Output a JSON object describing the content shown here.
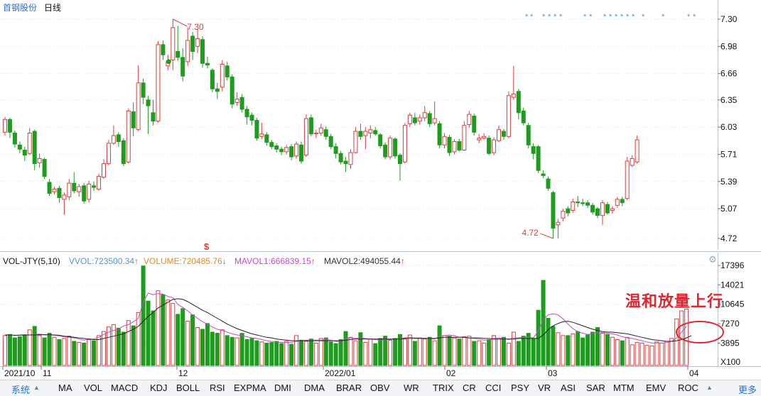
{
  "header": {
    "stock_name": "首钢股份",
    "period": "日线"
  },
  "price_axis": {
    "ticks": [
      "7.30",
      "6.98",
      "6.66",
      "6.35",
      "6.03",
      "5.71",
      "5.39",
      "5.07",
      "4.72"
    ]
  },
  "volume_axis": {
    "ticks": [
      "17396",
      "14021",
      "10645",
      "7270",
      "3895"
    ],
    "unit": "X100"
  },
  "date_axis": {
    "labels": [
      "2021/10",
      "11",
      "12",
      "2022/01",
      "02",
      "03",
      "04"
    ]
  },
  "markers": {
    "high_label": "7.30",
    "low_label": "4.72",
    "signal_label": "$"
  },
  "indicator": {
    "name": "VOL-JTY(5,10)",
    "items": [
      {
        "label": "VVOL:723500.34",
        "arrow": "↑",
        "color": "#4f95d6"
      },
      {
        "label": "VOLUME:720485.76",
        "arrow": "↓",
        "color": "#e08a1e"
      },
      {
        "label": "MAVOL1:666839.15",
        "arrow": "↑",
        "color": "#c44cc4"
      },
      {
        "label": "MAVOL2:494055.44",
        "arrow": "↑",
        "color": "#333333"
      }
    ]
  },
  "annotation": {
    "text": "温和放量上行"
  },
  "bottom_tabs": [
    "系统",
    "MA",
    "VOL",
    "MACD",
    "KDJ",
    "BOLL",
    "RSI",
    "EXPMA",
    "DMI",
    "DMA",
    "BRAR",
    "OBV",
    "WR",
    "TRIX",
    "CR",
    "CCI",
    "PSY",
    "VR",
    "ASI",
    "SAR",
    "MTM",
    "EMV",
    "ROC"
  ],
  "more_label": "更多",
  "colors": {
    "up": "#e03b3b",
    "down": "#1e9c1e",
    "ma1": "#c44cc4",
    "ma2": "#222222",
    "accent": "#2a72d5"
  },
  "chart_data": {
    "type": "candlestick",
    "title": "首钢股份 日线",
    "price_range": [
      4.62,
      7.36
    ],
    "volume_range": [
      0,
      17396
    ],
    "x_labels": [
      "2021/10",
      "11",
      "12",
      "2022/01",
      "02",
      "03",
      "04"
    ],
    "highest": 7.3,
    "lowest": 4.72,
    "candles": [
      {
        "o": 5.97,
        "c": 6.12,
        "h": 6.15,
        "l": 5.93
      },
      {
        "o": 6.12,
        "c": 5.97,
        "h": 6.14,
        "l": 5.9
      },
      {
        "o": 5.96,
        "c": 5.83,
        "h": 5.99,
        "l": 5.79
      },
      {
        "o": 5.82,
        "c": 5.77,
        "h": 5.86,
        "l": 5.72
      },
      {
        "o": 5.76,
        "c": 5.7,
        "h": 5.8,
        "l": 5.63
      },
      {
        "o": 5.72,
        "c": 5.96,
        "h": 6.02,
        "l": 5.7
      },
      {
        "o": 5.98,
        "c": 5.6,
        "h": 6.0,
        "l": 5.52
      },
      {
        "o": 5.61,
        "c": 5.66,
        "h": 5.72,
        "l": 5.55
      },
      {
        "o": 5.65,
        "c": 5.45,
        "h": 5.67,
        "l": 5.42
      },
      {
        "o": 5.38,
        "c": 5.25,
        "h": 5.42,
        "l": 5.22
      },
      {
        "o": 5.27,
        "c": 5.3,
        "h": 5.33,
        "l": 5.24
      },
      {
        "o": 5.31,
        "c": 5.2,
        "h": 5.34,
        "l": 5.14
      },
      {
        "o": 5.18,
        "c": 5.23,
        "h": 5.26,
        "l": 5.0
      },
      {
        "o": 5.21,
        "c": 5.37,
        "h": 5.42,
        "l": 5.17
      },
      {
        "o": 5.37,
        "c": 5.28,
        "h": 5.5,
        "l": 5.25
      },
      {
        "o": 5.27,
        "c": 5.33,
        "h": 5.36,
        "l": 5.21
      },
      {
        "o": 5.34,
        "c": 5.16,
        "h": 5.37,
        "l": 5.13
      },
      {
        "o": 5.18,
        "c": 5.36,
        "h": 5.4,
        "l": 5.14
      },
      {
        "o": 5.34,
        "c": 5.32,
        "h": 5.39,
        "l": 5.28
      },
      {
        "o": 5.3,
        "c": 5.45,
        "h": 5.48,
        "l": 5.28
      },
      {
        "o": 5.44,
        "c": 5.6,
        "h": 5.65,
        "l": 5.42
      },
      {
        "o": 5.6,
        "c": 5.84,
        "h": 5.88,
        "l": 5.58
      },
      {
        "o": 5.84,
        "c": 5.93,
        "h": 6.05,
        "l": 5.82
      },
      {
        "o": 5.94,
        "c": 5.86,
        "h": 5.97,
        "l": 5.8
      },
      {
        "o": 5.87,
        "c": 5.6,
        "h": 5.9,
        "l": 5.57
      },
      {
        "o": 5.62,
        "c": 6.22,
        "h": 6.25,
        "l": 5.6
      },
      {
        "o": 6.21,
        "c": 6.02,
        "h": 6.32,
        "l": 5.92
      },
      {
        "o": 6.0,
        "c": 6.55,
        "h": 6.76,
        "l": 5.98
      },
      {
        "o": 6.55,
        "c": 6.38,
        "h": 6.6,
        "l": 6.3
      },
      {
        "o": 6.35,
        "c": 6.28,
        "h": 6.4,
        "l": 5.95
      },
      {
        "o": 6.2,
        "c": 6.1,
        "h": 6.35,
        "l": 6.05
      },
      {
        "o": 6.1,
        "c": 7.0,
        "h": 7.04,
        "l": 6.08
      },
      {
        "o": 7.0,
        "c": 6.88,
        "h": 7.05,
        "l": 6.82
      },
      {
        "o": 6.75,
        "c": 6.8,
        "h": 6.88,
        "l": 6.7
      },
      {
        "o": 6.82,
        "c": 7.2,
        "h": 7.3,
        "l": 6.7
      },
      {
        "o": 6.92,
        "c": 6.85,
        "h": 7.22,
        "l": 6.81
      },
      {
        "o": 6.85,
        "c": 6.63,
        "h": 6.96,
        "l": 6.57
      },
      {
        "o": 6.8,
        "c": 7.05,
        "h": 7.2,
        "l": 6.75
      },
      {
        "o": 7.1,
        "c": 6.92,
        "h": 7.15,
        "l": 6.82
      },
      {
        "o": 6.98,
        "c": 7.07,
        "h": 7.18,
        "l": 6.9
      },
      {
        "o": 7.06,
        "c": 6.78,
        "h": 7.1,
        "l": 6.73
      },
      {
        "o": 6.78,
        "c": 6.76,
        "h": 6.86,
        "l": 6.72
      },
      {
        "o": 6.7,
        "c": 6.48,
        "h": 6.72,
        "l": 6.44
      },
      {
        "o": 6.48,
        "c": 6.45,
        "h": 6.55,
        "l": 6.36
      },
      {
        "o": 6.5,
        "c": 6.77,
        "h": 6.82,
        "l": 6.45
      },
      {
        "o": 6.75,
        "c": 6.62,
        "h": 6.8,
        "l": 6.58
      },
      {
        "o": 6.62,
        "c": 6.3,
        "h": 6.65,
        "l": 6.25
      },
      {
        "o": 6.32,
        "c": 6.36,
        "h": 6.44,
        "l": 6.28
      },
      {
        "o": 6.38,
        "c": 6.24,
        "h": 6.42,
        "l": 6.2
      },
      {
        "o": 6.24,
        "c": 6.15,
        "h": 6.28,
        "l": 6.06
      },
      {
        "o": 6.17,
        "c": 6.11,
        "h": 6.2,
        "l": 6.05
      },
      {
        "o": 6.11,
        "c": 5.9,
        "h": 6.14,
        "l": 5.87
      },
      {
        "o": 5.92,
        "c": 5.95,
        "h": 6.08,
        "l": 5.89
      },
      {
        "o": 5.94,
        "c": 5.85,
        "h": 5.97,
        "l": 5.81
      },
      {
        "o": 5.85,
        "c": 5.8,
        "h": 5.88,
        "l": 5.77
      },
      {
        "o": 5.81,
        "c": 5.77,
        "h": 5.84,
        "l": 5.73
      },
      {
        "o": 5.77,
        "c": 5.74,
        "h": 5.8,
        "l": 5.7
      },
      {
        "o": 5.74,
        "c": 5.79,
        "h": 5.82,
        "l": 5.71
      },
      {
        "o": 5.8,
        "c": 5.68,
        "h": 5.83,
        "l": 5.64
      },
      {
        "o": 5.69,
        "c": 5.83,
        "h": 5.86,
        "l": 5.66
      },
      {
        "o": 5.82,
        "c": 5.63,
        "h": 5.86,
        "l": 5.6
      },
      {
        "o": 5.7,
        "c": 6.13,
        "h": 6.18,
        "l": 5.68
      },
      {
        "o": 6.14,
        "c": 5.95,
        "h": 6.18,
        "l": 5.92
      },
      {
        "o": 5.95,
        "c": 5.96,
        "h": 6.0,
        "l": 5.9
      },
      {
        "o": 5.96,
        "c": 6.02,
        "h": 6.07,
        "l": 5.93
      },
      {
        "o": 6.0,
        "c": 5.92,
        "h": 6.04,
        "l": 5.88
      },
      {
        "o": 5.92,
        "c": 5.8,
        "h": 5.95,
        "l": 5.77
      },
      {
        "o": 5.8,
        "c": 5.72,
        "h": 5.84,
        "l": 5.66
      },
      {
        "o": 5.72,
        "c": 5.62,
        "h": 5.75,
        "l": 5.59
      },
      {
        "o": 5.63,
        "c": 5.6,
        "h": 5.68,
        "l": 5.5
      },
      {
        "o": 5.59,
        "c": 5.73,
        "h": 5.77,
        "l": 5.54
      },
      {
        "o": 5.73,
        "c": 5.98,
        "h": 6.03,
        "l": 5.72
      },
      {
        "o": 5.98,
        "c": 5.92,
        "h": 6.07,
        "l": 5.88
      },
      {
        "o": 5.93,
        "c": 5.98,
        "h": 6.03,
        "l": 5.77
      },
      {
        "o": 5.96,
        "c": 6.0,
        "h": 6.05,
        "l": 5.9
      },
      {
        "o": 5.99,
        "c": 5.95,
        "h": 6.03,
        "l": 5.93
      },
      {
        "o": 5.94,
        "c": 5.81,
        "h": 5.96,
        "l": 5.78
      },
      {
        "o": 5.82,
        "c": 5.68,
        "h": 5.85,
        "l": 5.65
      },
      {
        "o": 5.68,
        "c": 5.9,
        "h": 5.93,
        "l": 5.65
      },
      {
        "o": 5.89,
        "c": 5.69,
        "h": 5.91,
        "l": 5.66
      },
      {
        "o": 5.7,
        "c": 5.6,
        "h": 5.72,
        "l": 5.4
      },
      {
        "o": 5.62,
        "c": 6.05,
        "h": 6.08,
        "l": 5.6
      },
      {
        "o": 6.07,
        "c": 6.17,
        "h": 6.2,
        "l": 6.03
      },
      {
        "o": 6.14,
        "c": 6.08,
        "h": 6.2,
        "l": 6.05
      },
      {
        "o": 6.1,
        "c": 6.14,
        "h": 6.18,
        "l": 6.06
      },
      {
        "o": 6.14,
        "c": 6.2,
        "h": 6.28,
        "l": 6.1
      },
      {
        "o": 6.19,
        "c": 6.07,
        "h": 6.22,
        "l": 6.03
      },
      {
        "o": 6.08,
        "c": 6.13,
        "h": 6.33,
        "l": 6.05
      },
      {
        "o": 6.07,
        "c": 5.82,
        "h": 6.1,
        "l": 5.78
      },
      {
        "o": 5.82,
        "c": 5.92,
        "h": 5.96,
        "l": 5.78
      },
      {
        "o": 5.91,
        "c": 5.73,
        "h": 5.94,
        "l": 5.69
      },
      {
        "o": 5.74,
        "c": 5.86,
        "h": 5.89,
        "l": 5.71
      },
      {
        "o": 5.86,
        "c": 5.76,
        "h": 5.89,
        "l": 5.74
      },
      {
        "o": 5.76,
        "c": 6.05,
        "h": 6.1,
        "l": 5.75
      },
      {
        "o": 6.06,
        "c": 6.18,
        "h": 6.22,
        "l": 6.02
      },
      {
        "o": 6.16,
        "c": 5.97,
        "h": 6.19,
        "l": 5.93
      },
      {
        "o": 5.88,
        "c": 5.9,
        "h": 5.95,
        "l": 5.84
      },
      {
        "o": 5.9,
        "c": 5.92,
        "h": 5.96,
        "l": 5.88
      },
      {
        "o": 5.9,
        "c": 5.72,
        "h": 5.93,
        "l": 5.7
      },
      {
        "o": 5.73,
        "c": 5.88,
        "h": 5.91,
        "l": 5.7
      },
      {
        "o": 5.87,
        "c": 6.0,
        "h": 6.05,
        "l": 5.85
      },
      {
        "o": 5.98,
        "c": 5.92,
        "h": 6.01,
        "l": 5.88
      },
      {
        "o": 5.92,
        "c": 6.4,
        "h": 6.45,
        "l": 5.9
      },
      {
        "o": 6.38,
        "c": 6.42,
        "h": 6.75,
        "l": 6.35
      },
      {
        "o": 6.45,
        "c": 6.2,
        "h": 6.48,
        "l": 6.12
      },
      {
        "o": 6.22,
        "c": 6.08,
        "h": 6.26,
        "l": 6.05
      },
      {
        "o": 6.05,
        "c": 5.82,
        "h": 6.08,
        "l": 5.78
      },
      {
        "o": 5.8,
        "c": 5.72,
        "h": 5.84,
        "l": 5.65
      },
      {
        "o": 5.8,
        "c": 5.52,
        "h": 5.82,
        "l": 5.49
      },
      {
        "o": 5.48,
        "c": 5.46,
        "h": 5.52,
        "l": 5.43
      },
      {
        "o": 5.42,
        "c": 5.31,
        "h": 5.45,
        "l": 5.28
      },
      {
        "o": 5.26,
        "c": 4.84,
        "h": 5.28,
        "l": 4.72
      },
      {
        "o": 4.88,
        "c": 4.91,
        "h": 4.95,
        "l": 4.72
      },
      {
        "o": 4.96,
        "c": 5.04,
        "h": 5.07,
        "l": 4.92
      },
      {
        "o": 5.07,
        "c": 5.02,
        "h": 5.1,
        "l": 4.98
      },
      {
        "o": 5.05,
        "c": 5.15,
        "h": 5.19,
        "l": 5.02
      },
      {
        "o": 5.15,
        "c": 5.14,
        "h": 5.22,
        "l": 5.09
      },
      {
        "o": 5.14,
        "c": 5.13,
        "h": 5.19,
        "l": 5.1
      },
      {
        "o": 5.14,
        "c": 5.11,
        "h": 5.17,
        "l": 5.08
      },
      {
        "o": 5.11,
        "c": 5.03,
        "h": 5.14,
        "l": 5.0
      },
      {
        "o": 5.07,
        "c": 4.99,
        "h": 5.09,
        "l": 4.96
      },
      {
        "o": 4.99,
        "c": 5.14,
        "h": 5.17,
        "l": 4.88
      },
      {
        "o": 5.12,
        "c": 5.02,
        "h": 5.15,
        "l": 5.0
      },
      {
        "o": 5.05,
        "c": 5.07,
        "h": 5.1,
        "l": 5.01
      },
      {
        "o": 5.11,
        "c": 5.18,
        "h": 5.21,
        "l": 5.08
      },
      {
        "o": 5.18,
        "c": 5.14,
        "h": 5.21,
        "l": 5.1
      },
      {
        "o": 5.19,
        "c": 5.63,
        "h": 5.68,
        "l": 5.17
      },
      {
        "o": 5.58,
        "c": 5.66,
        "h": 5.7,
        "l": 5.56
      },
      {
        "o": 5.62,
        "c": 5.88,
        "h": 5.93,
        "l": 5.6
      }
    ],
    "volumes": [
      5200,
      5400,
      4800,
      5000,
      5300,
      6200,
      6800,
      5200,
      4800,
      5600,
      4900,
      4500,
      4700,
      5100,
      4200,
      4000,
      3900,
      4500,
      4300,
      5200,
      5900,
      6700,
      7100,
      6500,
      5800,
      7800,
      6900,
      9200,
      17300,
      11200,
      9500,
      13000,
      12300,
      11400,
      10800,
      8900,
      9900,
      7700,
      8800,
      6600,
      6300,
      7300,
      5800,
      5600,
      6200,
      5200,
      4900,
      4800,
      5600,
      4500,
      4700,
      4300,
      4100,
      3900,
      4000,
      4200,
      3800,
      4200,
      3700,
      5200,
      4400,
      4200,
      4600,
      3900,
      4700,
      4800,
      4100,
      3800,
      4500,
      5900,
      4900,
      4300,
      5700,
      4000,
      4600,
      3800,
      4700,
      5100,
      4400,
      4700,
      5400,
      4600,
      5300,
      4200,
      4800,
      4600,
      4900,
      4300,
      6900,
      5200,
      5100,
      4800,
      4600,
      5000,
      5100,
      4200,
      4300,
      3900,
      4500,
      5200,
      4600,
      4900,
      3900,
      5800,
      4200,
      5100,
      5600,
      4700,
      9600,
      14800,
      8200,
      6800,
      5700,
      5200,
      5200,
      5500,
      5900,
      4800,
      5300,
      5800,
      6600,
      5600,
      5400,
      4900,
      4500,
      4300,
      4900,
      3600,
      4000,
      3900,
      3500,
      3400,
      4100,
      3900,
      4200,
      4700,
      8100,
      9500,
      9800
    ],
    "ma_volume_1": [
      5300,
      5350,
      5200,
      5300,
      5350,
      5300,
      5400,
      5450,
      5300,
      5300,
      5250,
      5150,
      5000,
      4900,
      4800,
      4600,
      4400,
      4600,
      4600,
      4900,
      5400,
      5800,
      6100,
      6300,
      6900,
      7100,
      7600,
      8200,
      11000,
      12600,
      12300,
      12500,
      12400,
      12000,
      11800,
      10600,
      10100,
      9500,
      8800,
      8200,
      7600,
      7200,
      6700,
      6300,
      6100,
      5800,
      5500,
      5300,
      5200,
      5000,
      4800,
      4700,
      4500,
      4300,
      4200,
      4100,
      4000,
      4000,
      4000,
      4200,
      4300,
      4400,
      4400,
      4400,
      4400,
      4500,
      4400,
      4200,
      4200,
      4700,
      4800,
      4700,
      4800,
      4700,
      4600,
      4500,
      4400,
      4500,
      4500,
      4600,
      4700,
      4800,
      4900,
      4800,
      4800,
      4700,
      4700,
      4600,
      5100,
      5200,
      5300,
      5200,
      4900,
      4900,
      4800,
      4700,
      4600,
      4400,
      4400,
      4700,
      4800,
      4700,
      4500,
      4800,
      4800,
      4900,
      4900,
      4800,
      6000,
      7900,
      8800,
      9000,
      8800,
      8100,
      7200,
      6400,
      5900,
      5600,
      5400,
      5500,
      5700,
      5700,
      5600,
      5500,
      5300,
      5000,
      4800,
      4700,
      4500,
      4300,
      4100,
      3900,
      3900,
      3900,
      4000,
      4200,
      4800,
      5800,
      6800
    ],
    "ma_volume_2": [
      5300,
      5300,
      5250,
      5250,
      5300,
      5300,
      5300,
      5350,
      5350,
      5350,
      5300,
      5250,
      5100,
      5000,
      4900,
      4800,
      4700,
      4600,
      4500,
      4500,
      4700,
      4900,
      5100,
      5300,
      5500,
      5900,
      6300,
      6800,
      7700,
      8500,
      9200,
      10000,
      10500,
      11000,
      11500,
      11600,
      11500,
      11100,
      10600,
      10100,
      9600,
      9200,
      8700,
      8200,
      7700,
      7200,
      6800,
      6400,
      6100,
      5800,
      5500,
      5300,
      5100,
      4900,
      4800,
      4600,
      4500,
      4400,
      4300,
      4300,
      4300,
      4300,
      4300,
      4300,
      4300,
      4300,
      4300,
      4300,
      4300,
      4400,
      4500,
      4600,
      4600,
      4600,
      4600,
      4600,
      4600,
      4600,
      4600,
      4600,
      4600,
      4700,
      4700,
      4700,
      4700,
      4700,
      4700,
      4700,
      4800,
      4900,
      4900,
      4900,
      4900,
      4900,
      4800,
      4800,
      4800,
      4700,
      4700,
      4600,
      4600,
      4600,
      4600,
      4600,
      4700,
      4700,
      4700,
      4700,
      4700,
      5300,
      6200,
      6900,
      7300,
      7600,
      7700,
      7500,
      7200,
      6900,
      6600,
      6300,
      6100,
      5900,
      5800,
      5800,
      5700,
      5600,
      5500,
      5300,
      5100,
      4900,
      4700,
      4500,
      4400,
      4300,
      4200,
      4200,
      4300,
      4500,
      4800,
      5200
    ]
  }
}
